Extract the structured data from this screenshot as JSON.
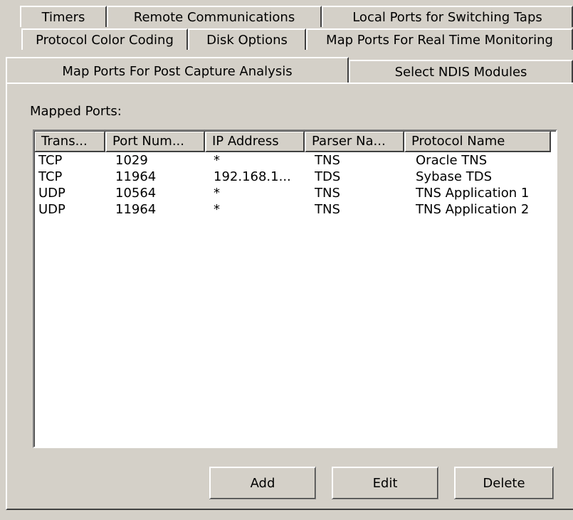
{
  "tabs": {
    "row1": [
      "Timers",
      "Remote Communications",
      "Local Ports for Switching Taps"
    ],
    "row2": [
      "Protocol Color Coding",
      "Disk Options",
      "Map Ports For Real Time Monitoring"
    ],
    "row3": [
      "Map Ports For Post Capture Analysis",
      "Select NDIS Modules"
    ],
    "selected": "Map Ports For Post Capture Analysis"
  },
  "panel": {
    "label": "Mapped Ports:"
  },
  "list": {
    "columns": [
      "Trans...",
      "Port Num...",
      "IP Address",
      "Parser Na...",
      "Protocol Name"
    ],
    "rows": [
      [
        "TCP",
        "1029",
        "*",
        "TNS",
        "Oracle TNS"
      ],
      [
        "TCP",
        "11964",
        "192.168.1...",
        "TDS",
        "Sybase TDS"
      ],
      [
        "UDP",
        "10564",
        "*",
        "TNS",
        "TNS Application 1"
      ],
      [
        "UDP",
        "11964",
        "*",
        "TNS",
        "TNS Application 2"
      ]
    ]
  },
  "buttons": {
    "add": "Add",
    "edit": "Edit",
    "delete": "Delete"
  }
}
